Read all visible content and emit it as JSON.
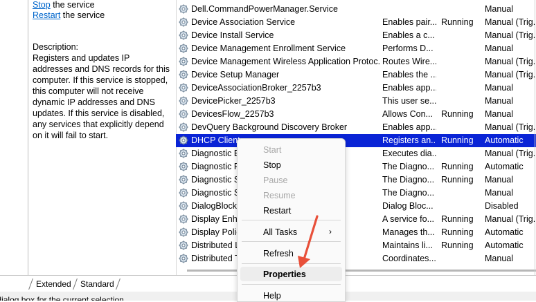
{
  "left_panel": {
    "actions": [
      {
        "link": "Stop",
        "rest": " the service"
      },
      {
        "link": "Restart",
        "rest": " the service"
      }
    ],
    "description": "Description:\nRegisters and updates IP addresses and DNS records for this computer. If this service is stopped, this computer will not receive dynamic IP addresses and DNS updates. If this service is disabled, any services that explicitly depend on it will fail to start."
  },
  "services": [
    {
      "name": "Dell.CommandPowerManager.Service",
      "description": "",
      "status": "",
      "startup": "Manual"
    },
    {
      "name": "Device Association Service",
      "description": "Enables pair...",
      "status": "Running",
      "startup": "Manual (Trig..."
    },
    {
      "name": "Device Install Service",
      "description": "Enables a c...",
      "status": "",
      "startup": "Manual (Trig..."
    },
    {
      "name": "Device Management Enrollment Service",
      "description": "Performs D...",
      "status": "",
      "startup": "Manual"
    },
    {
      "name": "Device Management Wireless Application Protoc...",
      "description": "Routes Wire...",
      "status": "",
      "startup": "Manual (Trig..."
    },
    {
      "name": "Device Setup Manager",
      "description": "Enables the ...",
      "status": "",
      "startup": "Manual (Trig..."
    },
    {
      "name": "DeviceAssociationBroker_2257b3",
      "description": "Enables app...",
      "status": "",
      "startup": "Manual"
    },
    {
      "name": "DevicePicker_2257b3",
      "description": "This user se...",
      "status": "",
      "startup": "Manual"
    },
    {
      "name": "DevicesFlow_2257b3",
      "description": "Allows Con...",
      "status": "Running",
      "startup": "Manual"
    },
    {
      "name": "DevQuery Background Discovery Broker",
      "description": "Enables app...",
      "status": "",
      "startup": "Manual (Trig..."
    },
    {
      "name": "DHCP Client",
      "description": "Registers an...",
      "status": "Running",
      "startup": "Automatic"
    },
    {
      "name": "Diagnostic E",
      "description": "Executes dia...",
      "status": "",
      "startup": "Manual (Trig..."
    },
    {
      "name": "Diagnostic P",
      "description": "The Diagno...",
      "status": "Running",
      "startup": "Automatic"
    },
    {
      "name": "Diagnostic S",
      "description": "The Diagno...",
      "status": "Running",
      "startup": "Manual"
    },
    {
      "name": "Diagnostic S",
      "description": "The Diagno...",
      "status": "",
      "startup": "Manual"
    },
    {
      "name": "DialogBlocki",
      "description": "Dialog Bloc...",
      "status": "",
      "startup": "Disabled"
    },
    {
      "name": "Display Enha",
      "description": "A service fo...",
      "status": "Running",
      "startup": "Manual (Trig..."
    },
    {
      "name": "Display Polic",
      "description": "Manages th...",
      "status": "Running",
      "startup": "Automatic"
    },
    {
      "name": "Distributed L",
      "description": "Maintains li...",
      "status": "Running",
      "startup": "Automatic"
    },
    {
      "name": "Distributed T",
      "description": "Coordinates...",
      "status": "",
      "startup": "Manual"
    }
  ],
  "tabs": {
    "extended": "Extended",
    "standard": "Standard"
  },
  "statusbar": "Opens the properties dialog box for the current selection.",
  "context_menu": {
    "start": "Start",
    "stop": "Stop",
    "pause": "Pause",
    "resume": "Resume",
    "restart": "Restart",
    "all_tasks": "All Tasks",
    "refresh": "Refresh",
    "properties": "Properties",
    "help": "Help"
  },
  "colors": {
    "selection": "#0a24d6",
    "link": "#0066cc",
    "annotation_arrow": "#e8503a"
  }
}
